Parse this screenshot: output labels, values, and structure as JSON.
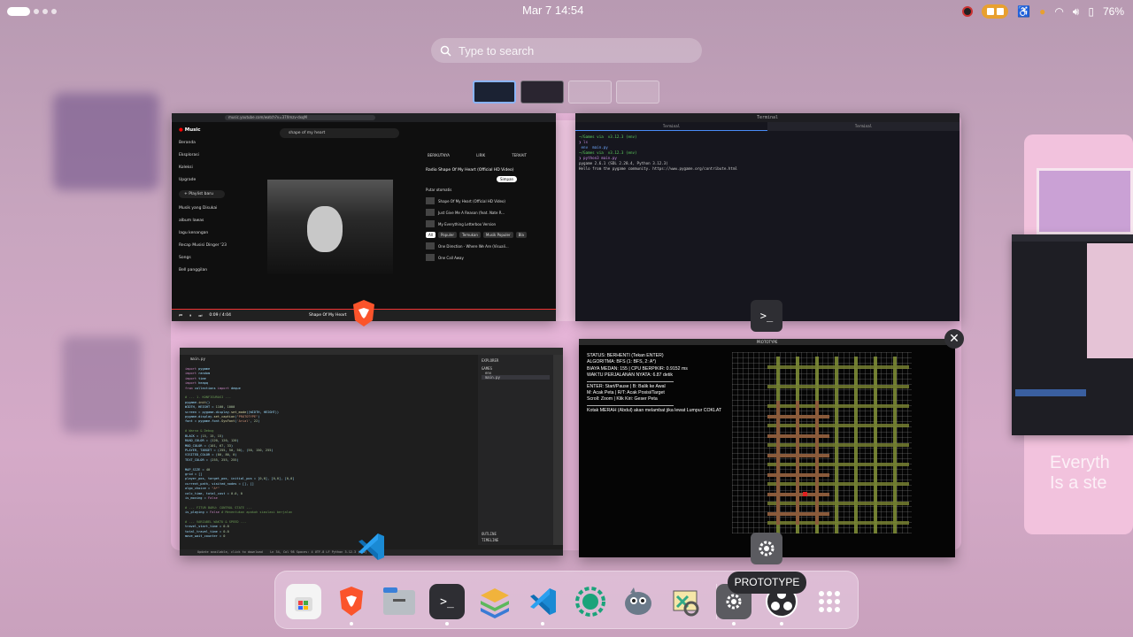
{
  "topbar": {
    "clock": "Mar 7  14:54",
    "battery": "76%"
  },
  "search": {
    "placeholder": "Type to search"
  },
  "windows": {
    "youtube": {
      "url": "music.youtube.com/watch?v=37Xmzv-dxqM",
      "logo": "Music",
      "search": "shape of my heart",
      "sidebar": [
        "Beranda",
        "Eksplorasi",
        "Koleksi",
        "Upgrade",
        "+ Playlist baru",
        "Musik yang Disukai",
        "album lawas",
        "lagu kenangan",
        "Recap Musisi Dinger '23",
        "Songs",
        "Bell panggilan"
      ],
      "panel_tabs": [
        "BERIKUTNYA",
        "LIRIK",
        "TERKAIT"
      ],
      "now_playing_label": "Radio Shape Of My Heart (Official HD Video)",
      "save": "Simpan",
      "autoplay": "Putar otomatis",
      "queue": [
        {
          "title": "Shape Of My Heart (Official HD Video)",
          "artist": "Backstreet Boys",
          "time": "4:40"
        },
        {
          "title": "Just Give Me A Reason (feat. Nate R...",
          "artist": "Pink",
          "time": "4:53"
        },
        {
          "title": "My Everything Letterbox Version",
          "artist": "98°",
          "time": "2:55"
        }
      ],
      "chips": [
        "All",
        "Populer",
        "Temukan",
        "Musik Populer",
        "Bla"
      ],
      "queue2": [
        {
          "title": "One Direction - Where We Are (Visuali...",
          "artist": "1DHQ",
          "time": "4:30"
        },
        {
          "title": "One Call Away",
          "artist": "Charlie Puth",
          "time": "4:32"
        },
        {
          "title": "Jet Lag (feat. Natasha Bedingfield)",
          "artist": "",
          "time": ""
        }
      ],
      "player_title": "Shape Of My Heart",
      "player_sub": "Backstreet Boys · BO...",
      "player_time": "0:09 / 4:04"
    },
    "terminal": {
      "title": "Terminal",
      "tabs": [
        "Terminal",
        "Terminal"
      ],
      "lines": [
        "~/Games via  v3.12.3 (env)",
        "❯ ls",
        " env  main.py",
        "",
        "~/Games via  v3.12.3 (env)",
        "❯ python3 main.py",
        "pygame 2.6.1 (SDL 2.28.4, Python 3.12.3)",
        "Hello from the pygame community. https://www.pygame.org/contribute.html"
      ]
    },
    "code": {
      "tab": "main.py",
      "explorer_title": "EXPLORER",
      "explorer_items": [
        "GAMES",
        "env",
        "main.py"
      ],
      "outline": "OUTLINE",
      "timeline": "TIMELINE",
      "status": "Ln 34, Col 98   Spaces: 4   UTF-8   LF   Python   3.12.3 (env)",
      "update": "Update available, click to download"
    },
    "prototype": {
      "title": "PROTOTYPE",
      "info": [
        "STATUS: BERHENTI (Tekan ENTER)",
        "ALGORITMA: BFS (1: BFS, 2: A*)",
        "BIAYA MEDAN: 155 | CPU BERPIKIR: 0.9152 ms",
        "WAKTU PERJALANAN NYATA: 6.87 detik",
        "",
        "ENTER: Start/Pause | B: Balik ke Awal",
        "M: Acak Peta | R/T: Acak Posisi/Target",
        "Scroll: Zoom | Klik Kiri: Geser Peta",
        "",
        "Kotak MERAH (Abdul) akan melambat jika lewat Lumpur COKLAT"
      ]
    }
  },
  "side": {
    "text_line1": "Everyth",
    "text_line2": "Is a ste"
  },
  "dock": {
    "items": [
      "software-store",
      "brave-browser",
      "files",
      "terminal",
      "layers-app",
      "vscode",
      "fragments-app",
      "gimp",
      "meld",
      "settings",
      "obs-studio",
      "app-grid"
    ],
    "tooltip": "PROTOTYPE"
  },
  "colors": {
    "accent": "#8ab4f8",
    "wallpaper": "#c8a5bf",
    "dock": "#ebd2e6"
  }
}
